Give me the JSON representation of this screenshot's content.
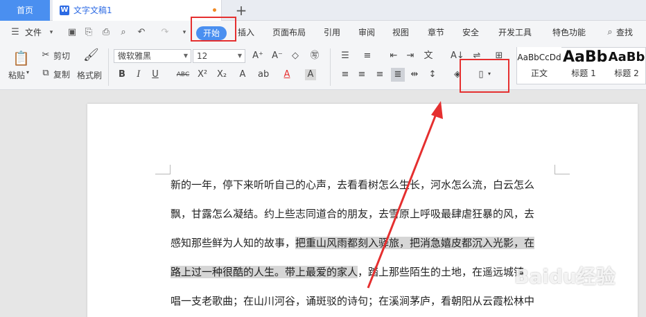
{
  "tabs": {
    "home_label": "首页",
    "doc_label": "文字文稿1",
    "doc_icon": "W",
    "new_tab": "+"
  },
  "menu": {
    "file_label": "文件",
    "items": [
      "开始",
      "插入",
      "页面布局",
      "引用",
      "审阅",
      "视图",
      "章节",
      "安全",
      "开发工具",
      "特色功能",
      "查找"
    ]
  },
  "ribbon": {
    "paste": "粘贴",
    "cut": "剪切",
    "copy": "复制",
    "format_painter": "格式刷",
    "font_name": "微软雅黑",
    "font_size": "12",
    "styles": [
      {
        "sample": "AaBbCcDd",
        "name": "正文"
      },
      {
        "sample": "AaBb",
        "name": "标题 1"
      },
      {
        "sample": "AaBb",
        "name": "标题 2"
      }
    ]
  },
  "document": {
    "lines": [
      {
        "plain": "新的一年，停下来听听自己的心声，去看看树怎么生长，河水怎么流，白云怎么",
        "hl": "",
        "after": ""
      },
      {
        "plain": "飘，甘露怎么凝结。约上些志同道合的朋友，去雪原上呼吸最肆虐狂暴的风，去",
        "hl": "",
        "after": ""
      },
      {
        "plain": "感知那些鲜为人知的故事，",
        "hl": "把重山风雨都刻入驿旅，把消急嬉皮都沉入光影，在",
        "after": ""
      },
      {
        "plain": "",
        "hl": "路上过一种很酷的人生。带上最爱的家人",
        "after": "，踏上那些陌生的土地，在遥远城镇"
      },
      {
        "plain": "唱一支老歌曲；在山川河谷，诵斑驳的诗句；在溪涧茅庐，看朝阳从云霞松林中",
        "hl": "",
        "after": ""
      }
    ]
  },
  "watermark": "Baidu经验",
  "colors": {
    "accent": "#4a8ff0",
    "annotation": "#e52f2f"
  }
}
